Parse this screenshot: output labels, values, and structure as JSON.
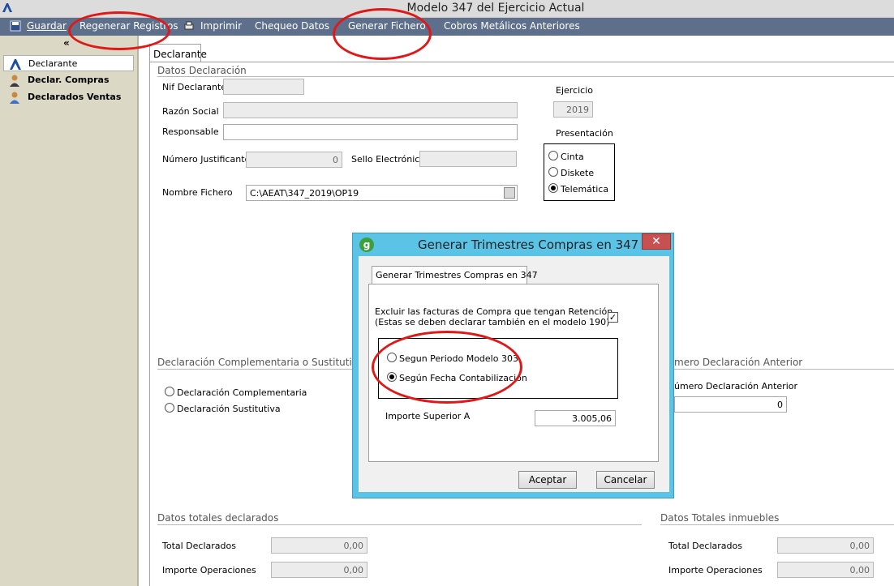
{
  "window": {
    "title": "Modelo 347 del Ejercicio Actual"
  },
  "toolbar": {
    "items": [
      {
        "label": "Guardar",
        "icon": "save-icon"
      },
      {
        "label": "Regenerar Registros"
      },
      {
        "label": "Imprimir",
        "icon": "print-icon"
      },
      {
        "label": "Chequeo Datos"
      },
      {
        "label": "Generar Fichero"
      },
      {
        "label": "Cobros Metálicos Anteriores"
      }
    ]
  },
  "sidebar": {
    "collapse": "«",
    "items": [
      {
        "label": "Declarante",
        "icon": "aeat-logo-icon",
        "selected": true
      },
      {
        "label": "Declar. Compras",
        "icon": "user-icon"
      },
      {
        "label": "Declarados Ventas",
        "icon": "user-icon"
      }
    ]
  },
  "main": {
    "tab": "Declarante",
    "datos": {
      "title": "Datos Declaración",
      "nif_label": "Nif Declarante",
      "nif_value": "",
      "razon_label": "Razón Social",
      "razon_value": "",
      "responsable_label": "Responsable",
      "responsable_value": "",
      "numero_label": "Número Justificante",
      "numero_value": "0",
      "sello_label": "Sello Electrónico",
      "sello_value": "",
      "fichero_label": "Nombre Fichero",
      "fichero_value": "C:\\AEAT\\347_2019\\OP19",
      "ejercicio_label": "Ejercicio",
      "ejercicio_value": "2019",
      "presentacion_label": "Presentación",
      "presentacion_options": [
        "Cinta",
        "Diskete",
        "Telemática"
      ],
      "presentacion_selected": "Telemática"
    },
    "complementaria": {
      "title": "Declaración Complementaria o Sustitutiva",
      "options": [
        "Declaración Complementaria",
        "Declaración Sustitutiva"
      ],
      "anterior_title": "mero Declaración Anterior",
      "anterior_label": "úmero Declaración Anterior",
      "anterior_value": "0"
    },
    "totales": {
      "title": "Datos totales declarados",
      "total_label": "Total Declarados",
      "total_value": "0,00",
      "importe_label": "Importe Operaciones",
      "importe_value": "0,00"
    },
    "inmuebles": {
      "title": "Datos Totales inmuebles",
      "total_label": "Total Declarados",
      "total_value": "0,00",
      "importe_label": "Importe Operaciones",
      "importe_value": "0,00"
    }
  },
  "dialog": {
    "title": "Generar Trimestres Compras en 347",
    "icon_letter": "g",
    "close": "✕",
    "tab": "Generar Trimestres Compras en 347",
    "exclude_line1": "Excluir las facturas de Compra que tengan Retención",
    "exclude_line2": "(Estas se deben declarar también en el modelo 190)",
    "exclude_checked": "✓",
    "options": [
      "Segun Periodo Modelo 303",
      "Según Fecha Contabilización"
    ],
    "selected_option": "Según Fecha Contabilización",
    "importe_label": "Importe Superior A",
    "importe_value": "3.005,06",
    "accept": "Aceptar",
    "cancel": "Cancelar"
  },
  "colors": {
    "toolbar": "#5d6f8a",
    "sidebar": "#dcd8c6",
    "dialog_frame": "#5bc3e6",
    "annotation": "#e01818"
  }
}
